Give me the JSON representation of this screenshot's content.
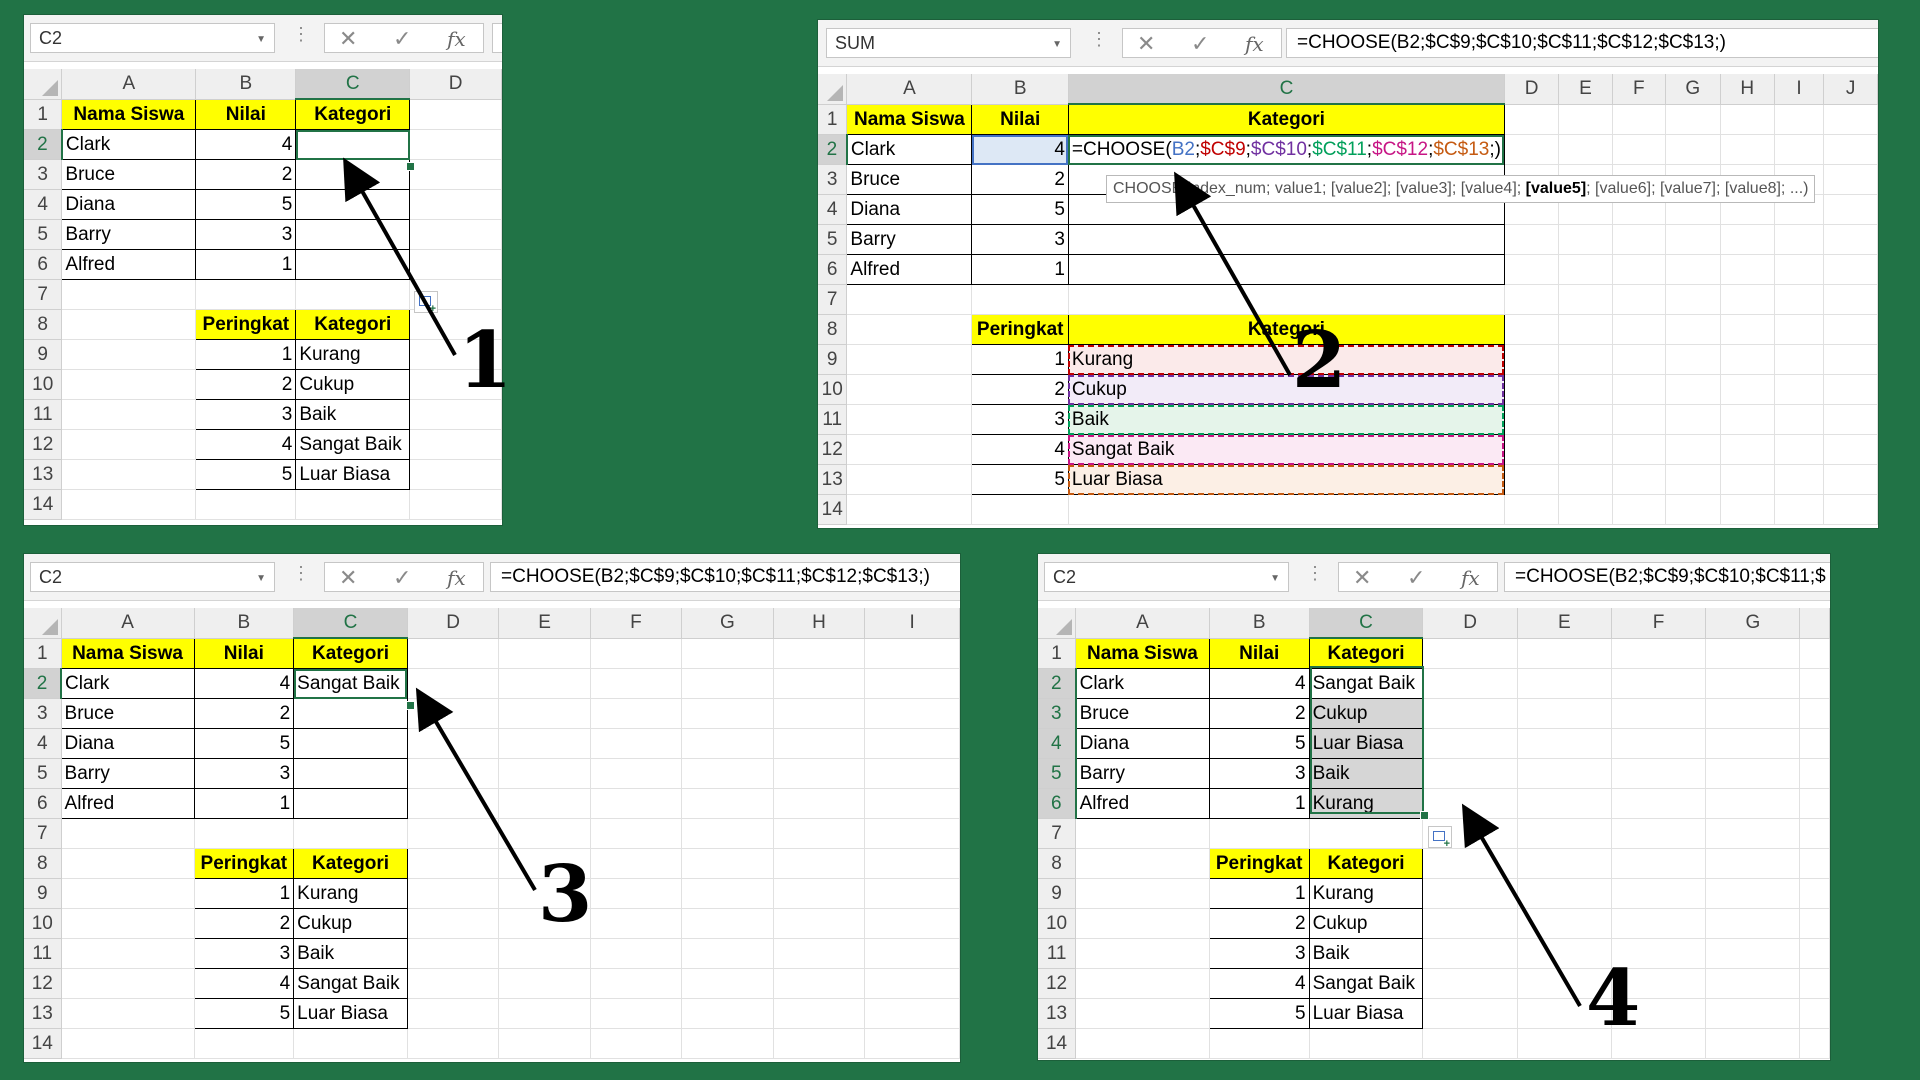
{
  "headers": {
    "name": "Nama Siswa",
    "score": "Nilai",
    "category": "Kategori",
    "rank": "Peringkat"
  },
  "students": [
    {
      "name": "Clark",
      "score": "4"
    },
    {
      "name": "Bruce",
      "score": "2"
    },
    {
      "name": "Diana",
      "score": "5"
    },
    {
      "name": "Barry",
      "score": "3"
    },
    {
      "name": "Alfred",
      "score": "1"
    }
  ],
  "lookup": [
    {
      "rank": "1",
      "category": "Kurang"
    },
    {
      "rank": "2",
      "category": "Cukup"
    },
    {
      "rank": "3",
      "category": "Baik"
    },
    {
      "rank": "4",
      "category": "Sangat Baik"
    },
    {
      "rank": "5",
      "category": "Luar Biasa"
    }
  ],
  "results": [
    "Sangat Baik",
    "Cukup",
    "Luar Biasa",
    "Baik",
    "Kurang"
  ],
  "formula_bar": {
    "cancel_glyph": "✕",
    "enter_glyph": "✓",
    "fx_label": "fx",
    "formula_full": "=CHOOSE(B2;$C$9;$C$10;$C$11;$C$12;$C$13;)",
    "formula_partial": "=CHOOSE(B2;$C$9;$C$10;$C$11;$",
    "formula_parts": {
      "fn": "=CHOOSE(",
      "b2": "B2",
      "c9": "$C$9",
      "c10": "$C$10",
      "c11": "$C$11",
      "c12": "$C$12",
      "c13": "$C$13",
      "sep": ";",
      "end": ";)"
    }
  },
  "panels": [
    {
      "name_box": "C2",
      "step": "1"
    },
    {
      "name_box": "SUM",
      "step": "2"
    },
    {
      "name_box": "C2",
      "step": "3"
    },
    {
      "name_box": "C2",
      "step": "4"
    }
  ],
  "tooltip": {
    "prefix": "CHOOSE(index_num; value1; [value2]; [value3]; [value4]; ",
    "bold": "[value5]",
    "suffix": "; [value6]; [value7]; [value8]; ...)"
  },
  "colors": {
    "background": "#217346",
    "header_fill": "#ffff00",
    "selection": "#217346",
    "ref_b2": "#4472c4",
    "ref_c9": "#c00000",
    "ref_c10": "#7030a0",
    "ref_c11": "#00a05a",
    "ref_c12": "#c71585",
    "ref_c13": "#c55a11"
  },
  "icons": [
    "dropdown-arrow-icon",
    "cancel-icon",
    "enter-check-icon",
    "insert-function-icon",
    "quick-analysis-icon"
  ]
}
